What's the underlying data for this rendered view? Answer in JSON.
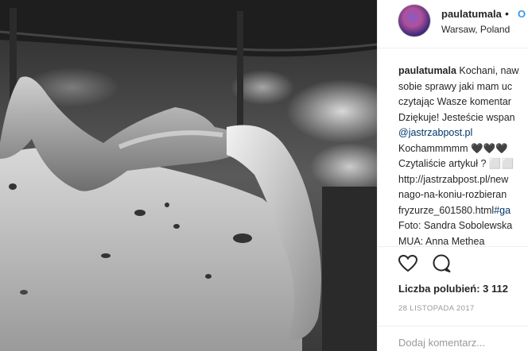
{
  "post": {
    "username": "paulatumala",
    "separator": "•",
    "follow_label": "O",
    "location": "Warsaw, Poland",
    "caption_lines": [
      {
        "user": "paulatumala",
        "text": " Kochani, naw"
      },
      {
        "text": "sobie sprawy jaki mam uc"
      },
      {
        "text": "czytając Wasze komentar"
      },
      {
        "text": "Dziękuje! Jesteście wspan"
      },
      {
        "link": "@jastrzabpost.pl"
      },
      {
        "text": "Kochammmmm 🖤🖤🖤"
      },
      {
        "text": "Czytaliście artykuł ? ⬜⬜"
      },
      {
        "text": "http://jastrzabpost.pl/new"
      },
      {
        "text": "nago-na-koniu-rozbieran"
      },
      {
        "text": "fryzurze_601580.html",
        "link": "#ga"
      },
      {
        "text": "Foto: Sandra Sobolewska"
      },
      {
        "text": "MUA: Anna Methea"
      }
    ],
    "likes_text": "Liczba polubień: 3 112",
    "date": "28 LISTOPADA 2017",
    "comment_placeholder": "Dodaj komentarz..."
  },
  "icons": {
    "like": "heart-outline-icon",
    "comment": "speech-bubble-icon"
  },
  "colors": {
    "link": "#003569",
    "follow": "#3897f0",
    "muted": "#999999",
    "border": "#efefef"
  }
}
